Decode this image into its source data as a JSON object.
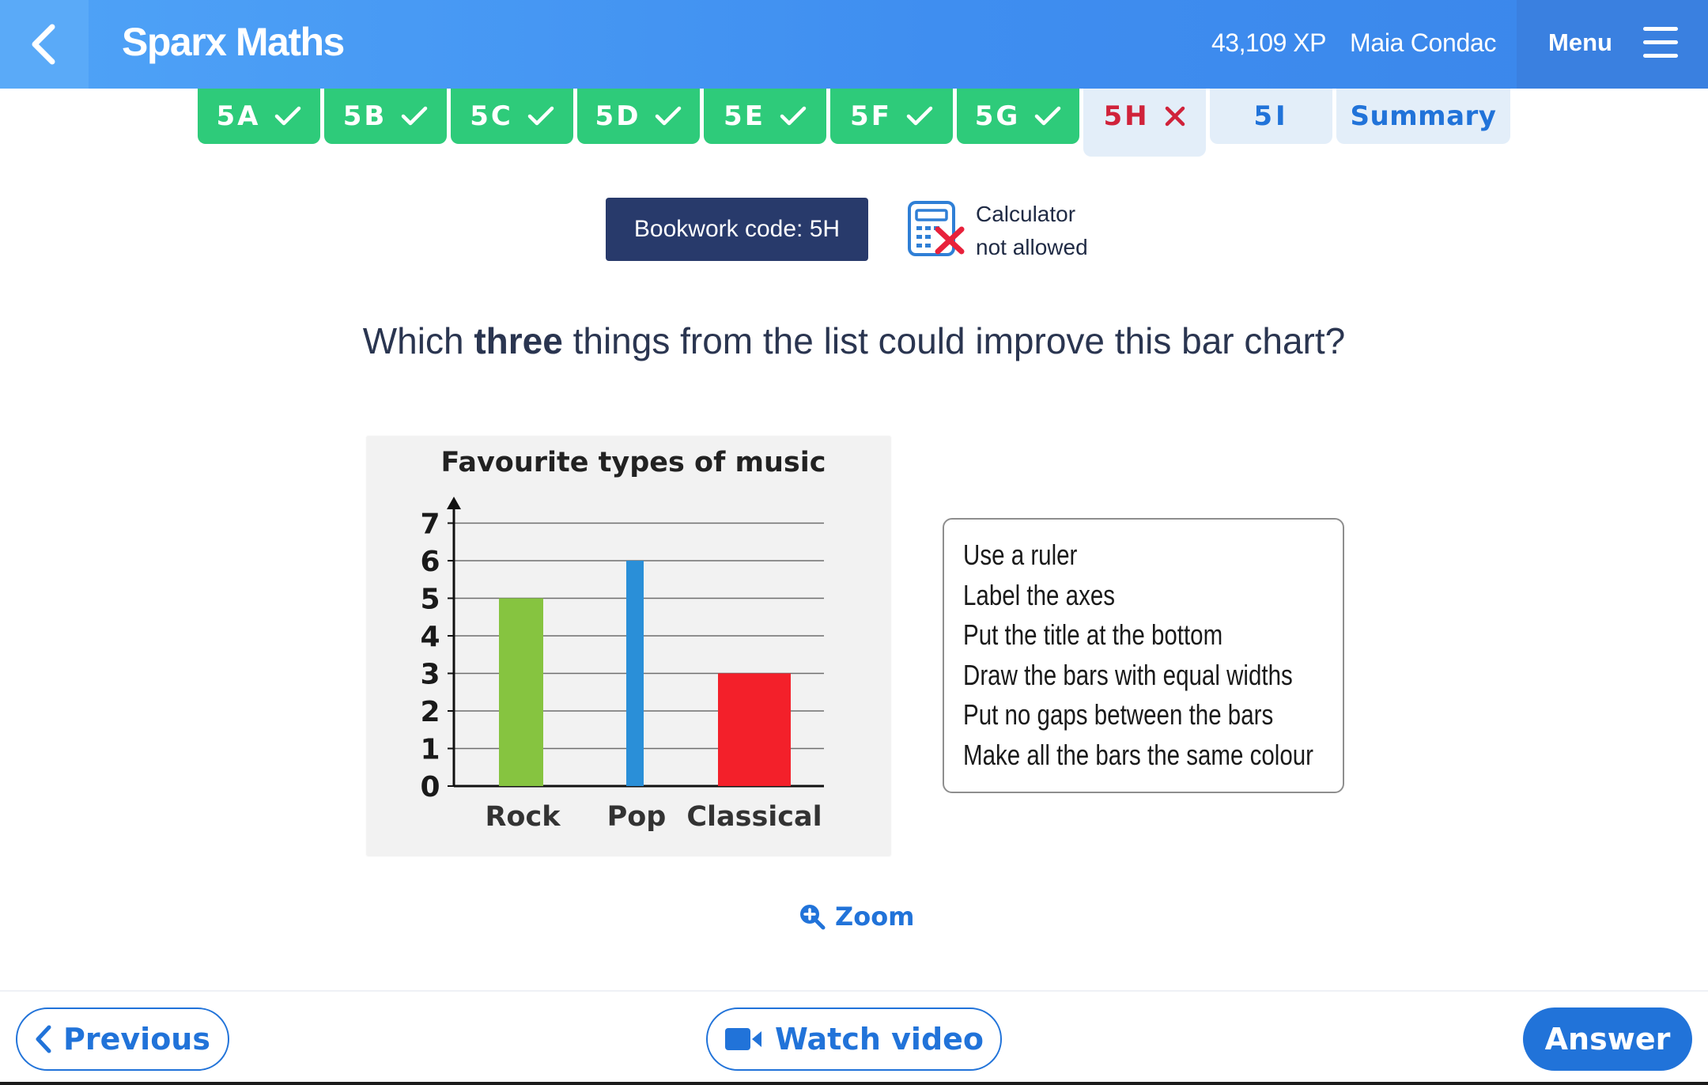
{
  "header": {
    "app_title": "Sparx Maths",
    "xp": "43,109 XP",
    "user_name": "Maia Condac",
    "menu_label": "Menu"
  },
  "tabs": [
    {
      "label": "5A",
      "status": "done"
    },
    {
      "label": "5B",
      "status": "done"
    },
    {
      "label": "5C",
      "status": "done"
    },
    {
      "label": "5D",
      "status": "done"
    },
    {
      "label": "5E",
      "status": "done"
    },
    {
      "label": "5F",
      "status": "done"
    },
    {
      "label": "5G",
      "status": "done"
    },
    {
      "label": "5H",
      "status": "wrong"
    },
    {
      "label": "5I",
      "status": "todo"
    },
    {
      "label": "Summary",
      "status": "summary"
    }
  ],
  "bookwork": {
    "label": "Bookwork code: 5H"
  },
  "calculator": {
    "line1": "Calculator",
    "line2": "not allowed"
  },
  "question": {
    "before": "Which ",
    "bold": "three",
    "after": " things from the list could improve this bar chart?"
  },
  "chart_data": {
    "type": "bar",
    "title": "Favourite types of music",
    "categories": [
      "Rock",
      "Pop",
      "Classical"
    ],
    "values": [
      5,
      6,
      3
    ],
    "colors": [
      "#86c440",
      "#2a8fd8",
      "#f3202a"
    ],
    "ylim": [
      0,
      7
    ],
    "yticks": [
      "0",
      "1",
      "2",
      "3",
      "4",
      "5",
      "6",
      "7"
    ],
    "xlabel": "",
    "ylabel": "",
    "grid": true
  },
  "options": [
    "Use a ruler",
    "Label the axes",
    "Put the title at the bottom",
    "Draw the bars with equal widths",
    "Put no gaps between the bars",
    "Make all the bars the same colour"
  ],
  "zoom_label": "Zoom",
  "footer": {
    "previous_label": "Previous",
    "video_label": "Watch video",
    "answer_label": "Answer"
  },
  "colors": {
    "header_blue": "#4fa3f7",
    "tab_done": "#2ecb7a",
    "tab_wrong_text": "#d0223a",
    "accent_blue": "#2173d9",
    "bookwork_bg": "#283a6b"
  }
}
